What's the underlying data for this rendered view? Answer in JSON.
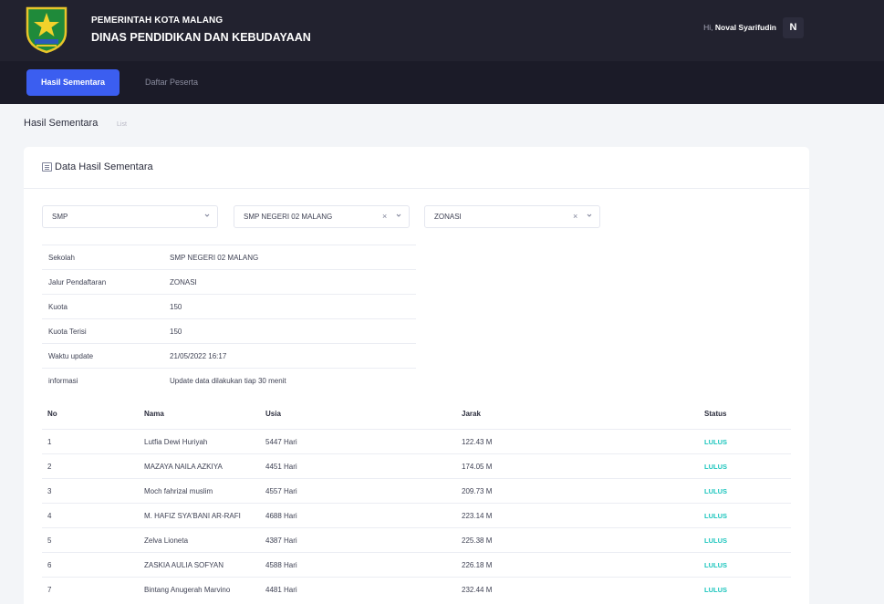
{
  "header": {
    "org_line_1": "PEMERINTAH KOTA MALANG",
    "org_line_2": "DINAS PENDIDIKAN DAN KEBUDAYAAN",
    "greeting_prefix": "Hi,",
    "user_name": "Noval Syarifudin",
    "avatar_initial": "N"
  },
  "nav": {
    "tabs": [
      {
        "label": "Hasil Sementara",
        "active": true
      },
      {
        "label": "Daftar Peserta",
        "active": false
      }
    ]
  },
  "page": {
    "title": "Hasil Sementara",
    "subtitle": "List"
  },
  "card": {
    "title": "Data Hasil Sementara"
  },
  "filters": {
    "level": "SMP",
    "school": "SMP NEGERI 02 MALANG",
    "route": "ZONASI",
    "clear_symbol": "×"
  },
  "info": [
    {
      "key": "Sekolah",
      "value": "SMP NEGERI 02 MALANG"
    },
    {
      "key": "Jalur Pendaftaran",
      "value": "ZONASI"
    },
    {
      "key": "Kuota",
      "value": "150"
    },
    {
      "key": "Kuota Terisi",
      "value": "150"
    },
    {
      "key": "Waktu update",
      "value": "21/05/2022 16:17"
    },
    {
      "key": "informasi",
      "value": "Update data dilakukan tiap 30 menit"
    }
  ],
  "results": {
    "columns": [
      "No",
      "Nama",
      "Usia",
      "Jarak",
      "Status"
    ],
    "rows": [
      {
        "no": "1",
        "nama": "Lutfia Dewi Huriyah",
        "usia": "5447 Hari",
        "jarak": "122.43 M",
        "status": "LULUS"
      },
      {
        "no": "2",
        "nama": "MAZAYA NAILA AZKIYA",
        "usia": "4451 Hari",
        "jarak": "174.05 M",
        "status": "LULUS"
      },
      {
        "no": "3",
        "nama": "Moch fahrizal muslim",
        "usia": "4557 Hari",
        "jarak": "209.73 M",
        "status": "LULUS"
      },
      {
        "no": "4",
        "nama": "M. HAFIZ SYA'BANI AR-RAFI",
        "usia": "4688 Hari",
        "jarak": "223.14 M",
        "status": "LULUS"
      },
      {
        "no": "5",
        "nama": "Zelva Lioneta",
        "usia": "4387 Hari",
        "jarak": "225.38 M",
        "status": "LULUS"
      },
      {
        "no": "6",
        "nama": "ZASKIA AULIA SOFYAN",
        "usia": "4588 Hari",
        "jarak": "226.18 M",
        "status": "LULUS"
      },
      {
        "no": "7",
        "nama": "Bintang Anugerah Marvino",
        "usia": "4481 Hari",
        "jarak": "232.44 M",
        "status": "LULUS"
      }
    ]
  },
  "colors": {
    "topbar": "#22222f",
    "navbar": "#1b1b28",
    "accent": "#3b5ef0",
    "status_success": "#1bc5bd"
  }
}
